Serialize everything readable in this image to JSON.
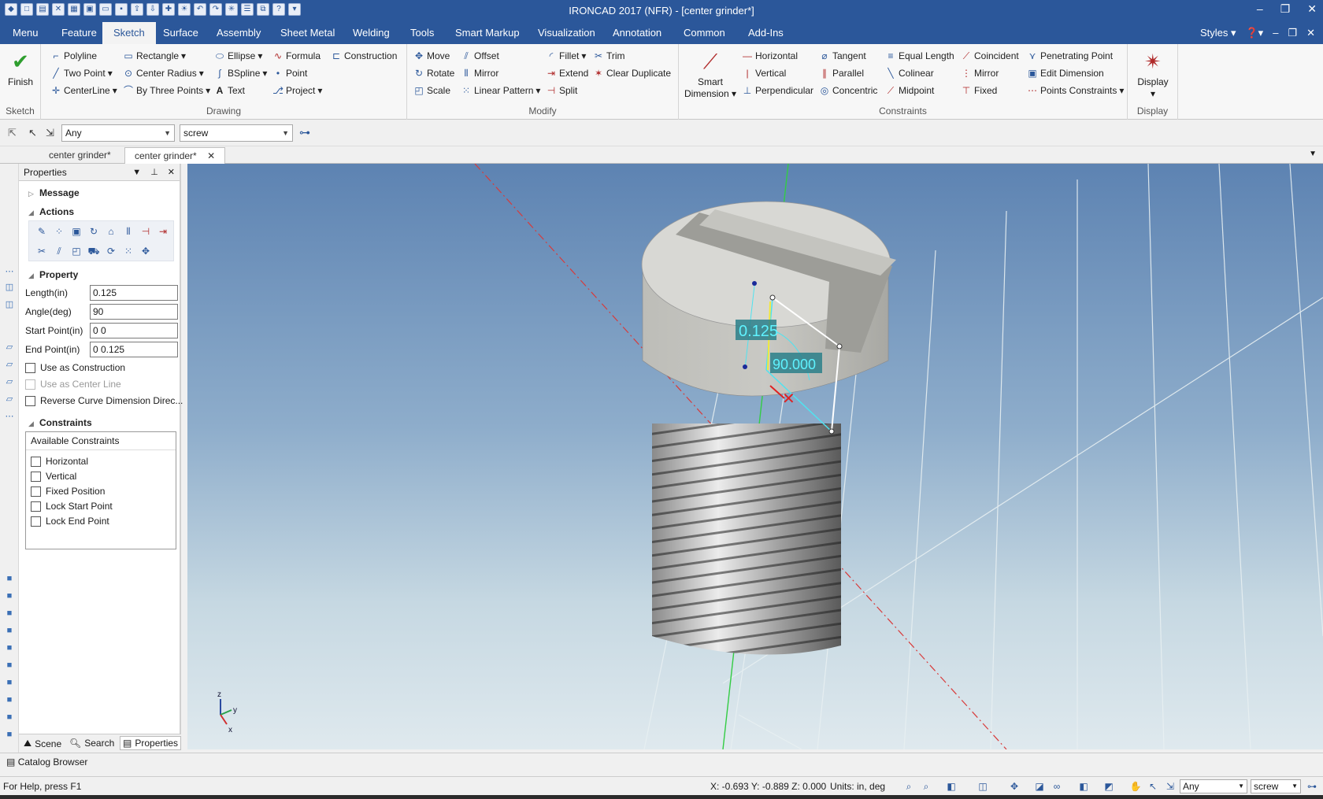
{
  "window": {
    "title": "IRONCAD 2017 (NFR) - [center grinder*]"
  },
  "menu": {
    "tabs": [
      "Menu",
      "Feature",
      "Sketch",
      "Surface",
      "Assembly",
      "Sheet Metal",
      "Welding",
      "Tools",
      "Smart Markup",
      "Visualization",
      "Annotation",
      "Common",
      "Add-Ins"
    ],
    "styles_label": "Styles"
  },
  "ribbon": {
    "sketch_group": {
      "finish_label": "Finish",
      "group_label": "Sketch"
    },
    "drawing_group": {
      "group_label": "Drawing",
      "polyline": "Polyline",
      "rectangle": "Rectangle",
      "ellipse": "Ellipse",
      "formula": "Formula",
      "construction": "Construction",
      "two_point": "Two Point",
      "center_radius": "Center Radius",
      "bspline": "BSpline",
      "point": "Point",
      "centerline": "CenterLine",
      "by_three_points": "By Three Points",
      "text": "Text",
      "project": "Project"
    },
    "modify_group": {
      "group_label": "Modify",
      "move": "Move",
      "offset": "Offset",
      "fillet": "Fillet",
      "trim": "Trim",
      "rotate": "Rotate",
      "mirror": "Mirror",
      "extend": "Extend",
      "clear_duplicate": "Clear Duplicate",
      "scale": "Scale",
      "linear_pattern": "Linear Pattern",
      "split": "Split"
    },
    "constraints_group": {
      "group_label": "Constraints",
      "smart_dimension_1": "Smart",
      "smart_dimension_2": "Dimension",
      "horizontal": "Horizontal",
      "tangent": "Tangent",
      "equal_length": "Equal Length",
      "coincident": "Coincident",
      "penetrating_point": "Penetrating Point",
      "vertical": "Vertical",
      "parallel": "Parallel",
      "colinear": "Colinear",
      "mirror": "Mirror",
      "edit_dimension": "Edit Dimension",
      "perpendicular": "Perpendicular",
      "concentric": "Concentric",
      "midpoint": "Midpoint",
      "fixed": "Fixed",
      "points_constraints": "Points Constraints"
    },
    "display_group": {
      "display_label": "Display",
      "group_label": "Display"
    }
  },
  "toolbar": {
    "filter_value": "Any",
    "part_value": "screw"
  },
  "doc_tabs": [
    "center grinder*",
    "center grinder*"
  ],
  "properties": {
    "title": "Properties",
    "message_section": "Message",
    "actions_section": "Actions",
    "property_section": "Property",
    "fields": [
      {
        "label": "Length(in)",
        "value": "0.125"
      },
      {
        "label": "Angle(deg)",
        "value": "90"
      },
      {
        "label": "Start Point(in)",
        "value": "0 0"
      },
      {
        "label": "End Point(in)",
        "value": "0 0.125"
      }
    ],
    "checkboxes": [
      {
        "label": "Use as Construction",
        "checked": false,
        "disabled": false
      },
      {
        "label": "Use as Center Line",
        "checked": false,
        "disabled": true
      },
      {
        "label": "Reverse Curve Dimension Direc...",
        "checked": false,
        "disabled": false
      }
    ],
    "constraints_section": "Constraints",
    "available_constraints_header": "Available Constraints",
    "constraints": [
      "Horizontal",
      "Vertical",
      "Fixed Position",
      "Lock Start Point",
      "Lock End Point"
    ],
    "bottom_tabs": [
      "Scene",
      "Search",
      "Properties"
    ]
  },
  "viewport": {
    "dimension_length": "0.125",
    "dimension_angle": "90.000",
    "triad_z": "z",
    "triad_y": "y",
    "triad_x": "x"
  },
  "catalog": {
    "label": "Catalog Browser"
  },
  "status": {
    "help": "For Help, press F1",
    "coords": "X: -0.693 Y: -0.889 Z: 0.000",
    "units": "Units: in, deg",
    "filter_value": "Any",
    "part_value": "screw"
  }
}
